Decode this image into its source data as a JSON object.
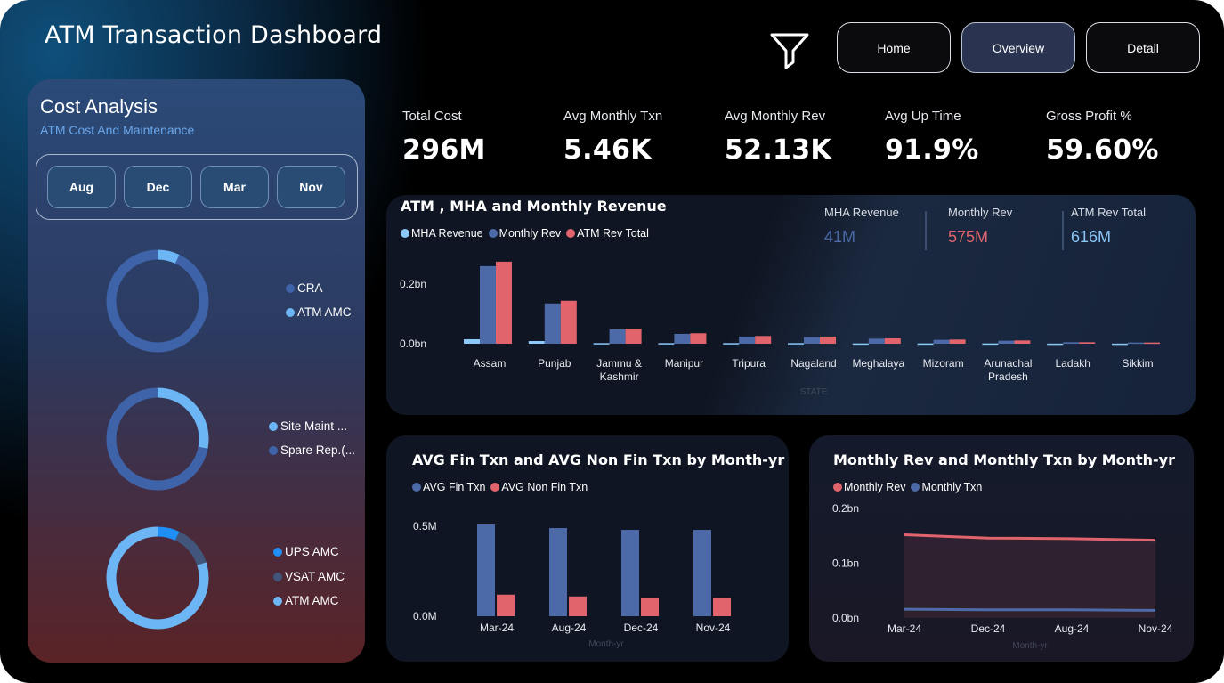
{
  "header": {
    "title": "ATM Transaction Dashboard",
    "nav": [
      {
        "label": "Home",
        "active": false
      },
      {
        "label": "Overview",
        "active": true
      },
      {
        "label": "Detail",
        "active": false
      }
    ],
    "filter_icon": "filter-icon"
  },
  "cost_panel": {
    "title": "Cost Analysis",
    "subtitle": "ATM Cost And Maintenance",
    "months": [
      "Aug",
      "Dec",
      "Mar",
      "Nov"
    ],
    "donuts": [
      {
        "legend": [
          {
            "label": "CRA",
            "color": "#3f63a8"
          },
          {
            "label": "ATM AMC",
            "color": "#6cb6f5"
          }
        ],
        "fractions": [
          0.93,
          0.07
        ]
      },
      {
        "legend": [
          {
            "label": "Site Maint ...",
            "color": "#6cb6f5"
          },
          {
            "label": "Spare Rep.(...",
            "color": "#3f63a8"
          }
        ],
        "fractions": [
          0.28,
          0.72
        ]
      },
      {
        "legend": [
          {
            "label": "UPS AMC",
            "color": "#1f8ef5"
          },
          {
            "label": "VSAT AMC",
            "color": "#42557a"
          },
          {
            "label": "ATM AMC",
            "color": "#6cb6f5"
          }
        ],
        "fractions": [
          0.07,
          0.13,
          0.8
        ]
      }
    ]
  },
  "kpis": [
    {
      "label": "Total Cost",
      "value": "296M"
    },
    {
      "label": "Avg Monthly Txn",
      "value": "5.46K"
    },
    {
      "label": "Avg Monthly Rev",
      "value": "52.13K"
    },
    {
      "label": "Avg Up Time",
      "value": "91.9%"
    },
    {
      "label": "Gross Profit %",
      "value": "59.60%"
    }
  ],
  "revenue_card": {
    "title": "ATM , MHA and Monthly Revenue",
    "kpis": [
      {
        "label": "MHA Revenue",
        "value": "41M",
        "color": "#4c6aa8"
      },
      {
        "label": "Monthly Rev",
        "value": "575M",
        "color": "#e1646d"
      },
      {
        "label": "ATM Rev Total",
        "value": "616M",
        "color": "#8cc8f8"
      }
    ]
  },
  "fin_card": {
    "title": "AVG Fin Txn and AVG Non Fin Txn by Month-yr"
  },
  "rev_txn_card": {
    "title": "Monthly Rev and Monthly Txn by Month-yr"
  },
  "chart_data": [
    {
      "type": "bar",
      "title": "ATM , MHA and Monthly Revenue",
      "xlabel": "STATE",
      "ylabel": "",
      "y_ticks": [
        "0.0bn",
        "0.2bn"
      ],
      "ylim": [
        0,
        0.28
      ],
      "categories": [
        "Assam",
        "Punjab",
        "Jammu & Kashmir",
        "Manipur",
        "Tripura",
        "Nagaland",
        "Meghalaya",
        "Mizoram",
        "Arunachal Pradesh",
        "Ladakh",
        "Sikkim"
      ],
      "series": [
        {
          "name": "MHA Revenue",
          "color": "#8cc8f8",
          "values": [
            0.015,
            0.009,
            0.002,
            0.002,
            0.002,
            0.002,
            0.001,
            0.001,
            0.001,
            0.0005,
            0.0005
          ]
        },
        {
          "name": "Monthly Rev",
          "color": "#4c6aa8",
          "values": [
            0.26,
            0.135,
            0.048,
            0.033,
            0.024,
            0.022,
            0.017,
            0.013,
            0.01,
            0.005,
            0.004
          ]
        },
        {
          "name": "ATM Rev Total",
          "color": "#e1646d",
          "values": [
            0.275,
            0.144,
            0.05,
            0.035,
            0.026,
            0.024,
            0.018,
            0.014,
            0.011,
            0.005,
            0.004
          ]
        }
      ]
    },
    {
      "type": "bar",
      "title": "AVG Fin Txn and AVG Non Fin Txn by Month-yr",
      "xlabel": "Month-yr",
      "ylabel": "",
      "y_ticks": [
        "0.0M",
        "0.5M"
      ],
      "ylim": [
        0,
        0.5
      ],
      "categories": [
        "Mar-24",
        "Aug-24",
        "Dec-24",
        "Nov-24"
      ],
      "series": [
        {
          "name": "AVG Fin Txn",
          "color": "#4c6aa8",
          "values": [
            0.51,
            0.49,
            0.48,
            0.48
          ]
        },
        {
          "name": "AVG Non Fin Txn",
          "color": "#e1646d",
          "values": [
            0.12,
            0.11,
            0.1,
            0.1
          ]
        }
      ]
    },
    {
      "type": "area",
      "title": "Monthly Rev and Monthly Txn by Month-yr",
      "xlabel": "Month-yr",
      "ylabel": "",
      "y_ticks": [
        "0.0bn",
        "0.1bn",
        "0.2bn"
      ],
      "ylim": [
        0,
        0.2
      ],
      "categories": [
        "Mar-24",
        "Dec-24",
        "Aug-24",
        "Nov-24"
      ],
      "series": [
        {
          "name": "Monthly Rev",
          "color": "#e1646d",
          "values": [
            0.152,
            0.146,
            0.145,
            0.142
          ]
        },
        {
          "name": "Monthly Txn",
          "color": "#4c6aa8",
          "values": [
            0.016,
            0.015,
            0.015,
            0.014
          ]
        }
      ]
    }
  ]
}
